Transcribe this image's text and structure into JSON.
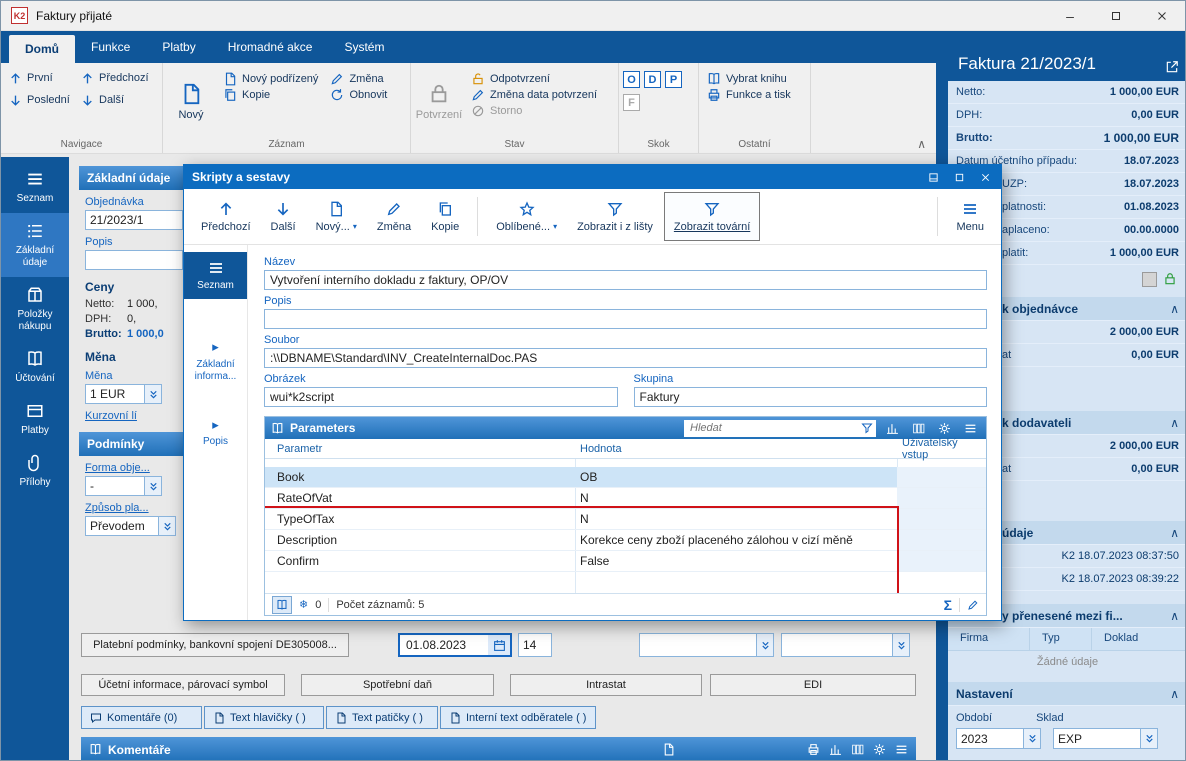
{
  "icons": {
    "minimize": "–",
    "chevron_up": "∧",
    "play": "▸",
    "caret_down": "▾",
    "snowflake": "❄",
    "sigma": "Σ"
  },
  "window": {
    "logo": "K2",
    "title": "Faktury přijaté"
  },
  "menu": {
    "tabs": [
      {
        "label": "Domů"
      },
      {
        "label": "Funkce"
      },
      {
        "label": "Platby"
      },
      {
        "label": "Hromadné akce"
      },
      {
        "label": "Systém"
      }
    ]
  },
  "ribbon": {
    "navigace": {
      "label": "Navigace",
      "prvni": "První",
      "predchozi": "Předchozí",
      "posledni": "Poslední",
      "dalsi": "Další"
    },
    "zaznam": {
      "label": "Záznam",
      "novy": "Nový",
      "novy_podrizeny": "Nový podřízený",
      "kopie": "Kopie",
      "zmena": "Změna",
      "obnovit": "Obnovit"
    },
    "stav": {
      "label": "Stav",
      "potvrzeni": "Potvrzení",
      "odpotvrzeni": "Odpotvrzení",
      "zmena_data": "Změna data potvrzení",
      "storno": "Storno"
    },
    "skok": {
      "label": "Skok",
      "o": "O",
      "d": "D",
      "p": "P",
      "f": "F"
    },
    "ostatni": {
      "label": "Ostatní",
      "vybrat_knihu": "Vybrat knihu",
      "funkce_tisk": "Funkce a tisk"
    }
  },
  "sidebar": {
    "items": [
      {
        "label": "Seznam"
      },
      {
        "label": "Základní údaje"
      },
      {
        "label": "Položky nákupu"
      },
      {
        "label": "Účtování"
      },
      {
        "label": "Platby"
      },
      {
        "label": "Přílohy"
      }
    ]
  },
  "form": {
    "header": "Základní údaje",
    "objednavka_label": "Objednávka",
    "objednavka_value": "21/2023/1",
    "popis_label": "Popis",
    "popis_value": "",
    "ceny_header": "Ceny",
    "netto_label": "Netto:",
    "netto_value": "1 000,",
    "dph_label": "DPH:",
    "dph_value": "0,",
    "brutto_label": "Brutto:",
    "brutto_value": "1 000,0",
    "mena_header": "Měna",
    "mena_label": "Měna",
    "mena_value": "1 EUR",
    "kurzovni_link": "Kurzovní lí",
    "podminky_header": "Podmínky",
    "forma_label": "Forma obje...",
    "forma_value": "-",
    "zpusob_label": "Způsob pla...",
    "zpusob_value": "Převodem"
  },
  "bottom": {
    "platebni": "Platební podmínky, bankovní spojení DE305008...",
    "datum": "01.08.2023",
    "dny": "14",
    "ucetni": "Účetní informace, párovací symbol",
    "spotrebni": "Spotřební daň",
    "intrastat": "Intrastat",
    "edi": "EDI",
    "tab_komentare": "Komentáře (0)",
    "tab_hlavicky": "Text hlavičky ( )",
    "tab_paticky": "Text patičky ( )",
    "tab_interni": "Interní text odběratele ( )",
    "komentare_header": "Komentáře"
  },
  "dialog": {
    "title": "Skripty a sestavy",
    "toolbar": {
      "predchozi": "Předchozí",
      "dalsi": "Další",
      "novy": "Nový...",
      "zmena": "Změna",
      "kopie": "Kopie",
      "oblibene": "Oblíbené...",
      "zobrazit_listy": "Zobrazit i z lišty",
      "zobrazit_tovarni": "Zobrazit tovární",
      "menu": "Menu"
    },
    "sidebar": [
      {
        "label": "Seznam"
      },
      {
        "label": "Základní informa..."
      },
      {
        "label": "Popis"
      }
    ],
    "fields": {
      "nazev_label": "Název",
      "nazev_value": "Vytvoření interního dokladu z faktury, OP/OV",
      "popis_label": "Popis",
      "popis_value": "",
      "soubor_label": "Soubor",
      "soubor_value": ":\\\\DBNAME\\Standard\\INV_CreateInternalDoc.PAS",
      "obrazek_label": "Obrázek",
      "obrazek_value": "wui*k2script",
      "skupina_label": "Skupina",
      "skupina_value": "Faktury"
    },
    "parameters": {
      "title": "Parameters",
      "search_placeholder": "Hledat",
      "columns": [
        "Parametr",
        "Hodnota",
        "Uživatelský vstup"
      ],
      "rows": [
        {
          "param": "Book",
          "value": "OB"
        },
        {
          "param": "RateOfVat",
          "value": "N"
        },
        {
          "param": "TypeOfTax",
          "value": "N"
        },
        {
          "param": "Description",
          "value": "Korekce ceny zboží placeného zálohou v cizí měně"
        },
        {
          "param": "Confirm",
          "value": "False"
        }
      ],
      "badge": "0",
      "status_records": "Počet záznamů: 5"
    }
  },
  "panel": {
    "title": "Faktura 21/2023/1",
    "rows": [
      {
        "label": "Netto:",
        "value": "1 000,00 EUR"
      },
      {
        "label": "DPH:",
        "value": "0,00 EUR"
      },
      {
        "label": "Brutto:",
        "value": "1 000,00 EUR"
      },
      {
        "label": "Datum účetního případu:",
        "value": "18.07.2023"
      },
      {
        "label": "UZP:",
        "value": "18.07.2023"
      },
      {
        "label": "platnosti:",
        "value": "01.08.2023"
      },
      {
        "label": "aplaceno:",
        "value": "00.00.0000"
      },
      {
        "label": "platit:",
        "value": "1 000,00 EUR"
      }
    ],
    "section_objednavka": {
      "header": "k objednávce",
      "value1": "2 000,00 EUR",
      "label2": "at",
      "value2": "0,00 EUR"
    },
    "section_dodavatel": {
      "header": "k dodavateli",
      "value1": "2 000,00 EUR",
      "label2": "at",
      "value2": "0,00 EUR"
    },
    "section_udaje": {
      "header": "údaje",
      "row1": "K2 18.07.2023 08:37:50",
      "row2": "K2 18.07.2023 08:39:22"
    },
    "section_prenesene": {
      "header": "y přenesené mezi fi...",
      "columns": [
        "Firma",
        "Typ",
        "Doklad"
      ],
      "empty_text": "Žádné údaje"
    },
    "section_nastaveni": {
      "header": "Nastavení",
      "obdobi_label": "Období",
      "obdobi_value": "2023",
      "sklad_label": "Sklad",
      "sklad_value": "EXP"
    }
  }
}
